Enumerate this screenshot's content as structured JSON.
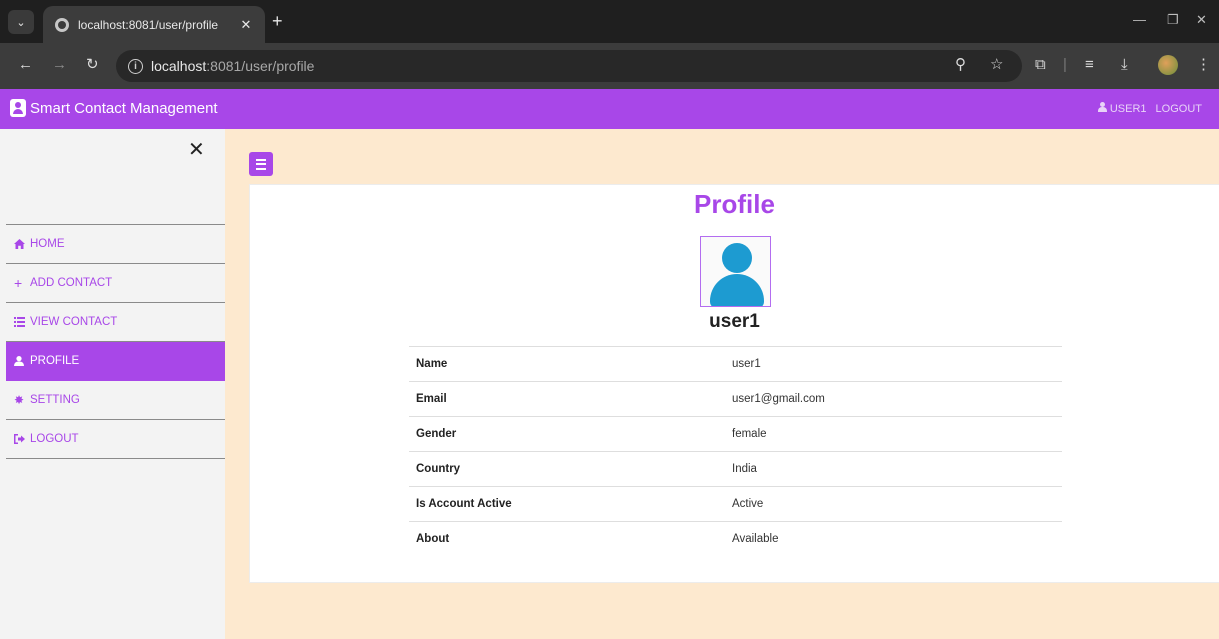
{
  "browser": {
    "tab_title": "localhost:8081/user/profile",
    "url_host": "localhost",
    "url_path": ":8081/user/profile"
  },
  "navbar": {
    "brand": "Smart Contact Management",
    "user_label": "USER1",
    "logout_label": "LOGOUT",
    "color": "#a847e8"
  },
  "sidebar": {
    "items": [
      {
        "label": "HOME",
        "icon": "home-icon"
      },
      {
        "label": "ADD CONTACT",
        "icon": "plus-icon"
      },
      {
        "label": "VIEW CONTACT",
        "icon": "list-icon"
      },
      {
        "label": "PROFILE",
        "icon": "user-icon",
        "active": true
      },
      {
        "label": "SETTING",
        "icon": "gear-icon"
      },
      {
        "label": "LOGOUT",
        "icon": "sign-out-icon"
      }
    ]
  },
  "profile": {
    "title": "Profile",
    "username": "user1",
    "rows": [
      {
        "key": "Name",
        "value": "user1"
      },
      {
        "key": "Email",
        "value": "user1@gmail.com"
      },
      {
        "key": "Gender",
        "value": "female"
      },
      {
        "key": "Country",
        "value": "India"
      },
      {
        "key": "Is Account Active",
        "value": "Active"
      },
      {
        "key": "About",
        "value": "Available"
      }
    ]
  },
  "colors": {
    "accent": "#a847e8",
    "content_bg": "#fde9cf",
    "avatar": "#1d9bd1"
  }
}
